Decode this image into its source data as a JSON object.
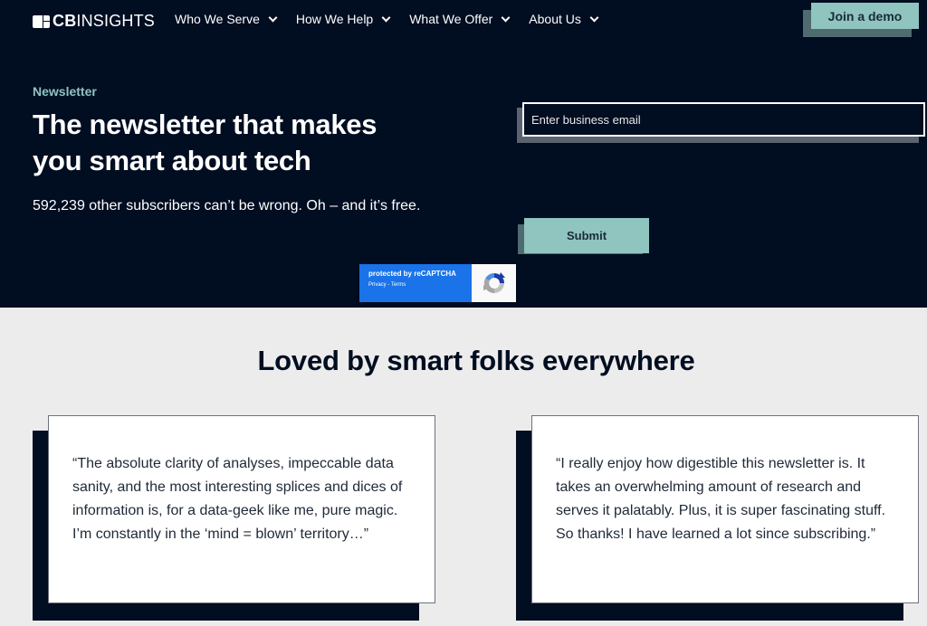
{
  "header": {
    "logo": {
      "bold": "CB",
      "light": "INSIGHTS"
    },
    "nav": [
      {
        "label": "Who We Serve"
      },
      {
        "label": "How We Help"
      },
      {
        "label": "What We Offer"
      },
      {
        "label": "About Us"
      }
    ],
    "cta_label": "Join a demo"
  },
  "hero": {
    "eyebrow": "Newsletter",
    "title": "The newsletter that makes you smart about tech",
    "subtitle": "592,239 other subscribers can’t be wrong. Oh – and it’s free.",
    "email_placeholder": "Enter business email",
    "submit_label": "Submit",
    "recaptcha": {
      "line1": "protected by reCAPTCHA",
      "line2": "Privacy - Terms"
    }
  },
  "testimonials": {
    "title": "Loved by smart folks everywhere",
    "items": [
      {
        "quote": "“The absolute clarity of analyses, impeccable data sanity, and the most interesting splices and dices of information is, for a data-geek like me, pure magic. I’m constantly in the ‘mind = blown’ territory…”"
      },
      {
        "quote": "“I really enjoy how digestible this newsletter is. It takes an overwhelming amount of research and serves it palatably. Plus, it is super fascinating stuff. So thanks! I have learned a lot since subscribing.”"
      }
    ]
  },
  "colors": {
    "navy": "#010d21",
    "accent_teal": "#8fc4bf",
    "recaptcha_blue": "#1a73e8",
    "page_bg": "#ececec"
  }
}
